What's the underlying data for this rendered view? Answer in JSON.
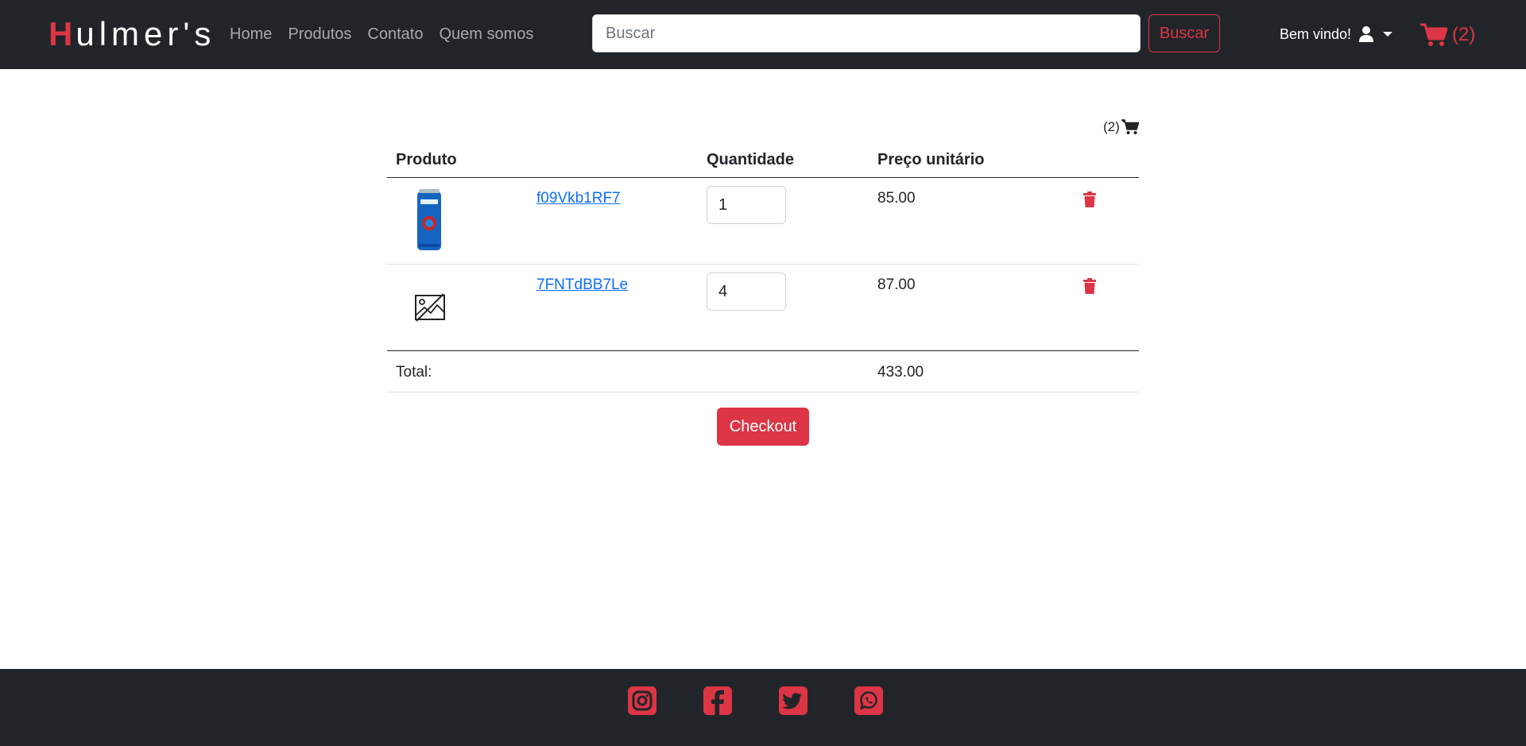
{
  "brand": {
    "first_letter": "H",
    "rest": "ulmer's"
  },
  "nav": {
    "items": [
      {
        "label": "Home"
      },
      {
        "label": "Produtos"
      },
      {
        "label": "Contato"
      },
      {
        "label": "Quem somos"
      }
    ]
  },
  "search": {
    "placeholder": "Buscar",
    "value": "",
    "button_label": "Buscar"
  },
  "user_menu": {
    "welcome": "Bem vindo!",
    "icon": "user-icon"
  },
  "cart_nav": {
    "count_label": "(2)",
    "icon": "cart-icon"
  },
  "cart": {
    "badge": "(2)",
    "headers": {
      "product": "Produto",
      "quantity": "Quantidade",
      "unit_price": "Preço unitário"
    },
    "items": [
      {
        "image": "beer-can",
        "name": "f09Vkb1RF7",
        "quantity": "1",
        "unit_price": "85.00"
      },
      {
        "image": "image-placeholder",
        "name": "7FNTdBB7Le",
        "quantity": "4",
        "unit_price": "87.00"
      }
    ],
    "total_label": "Total:",
    "total_value": "433.00",
    "checkout_label": "Checkout"
  },
  "footer": {
    "social": [
      "instagram-icon",
      "facebook-icon",
      "twitter-icon",
      "whatsapp-icon"
    ]
  },
  "colors": {
    "accent": "#dc3545",
    "dark": "#212529",
    "link": "#0d6efd"
  }
}
